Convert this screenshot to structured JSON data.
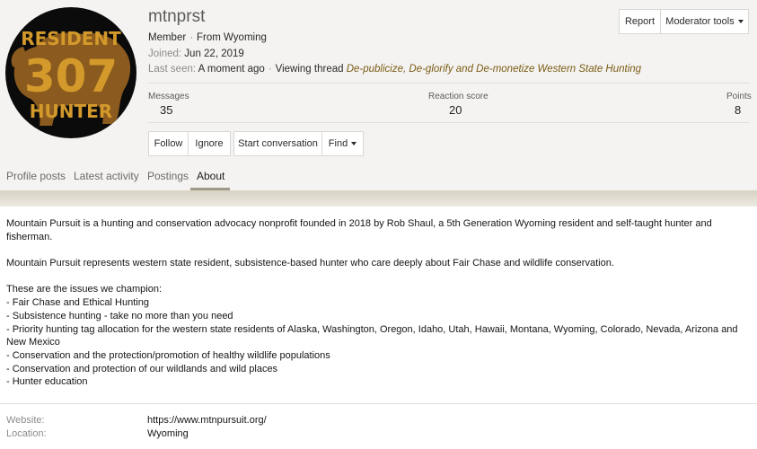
{
  "profile": {
    "username": "mtnprst",
    "role": "Member",
    "from": "From Wyoming",
    "joined_label": "Joined:",
    "joined_value": "Jun 22, 2019",
    "last_seen_label": "Last seen:",
    "last_seen_value": "A moment ago",
    "activity_text": "Viewing thread",
    "activity_thread": "De-publicize, De-glorify and De-monetize Western State Hunting",
    "avatar_text": [
      "RESIDENT",
      "307",
      "HUNTER"
    ]
  },
  "actions": {
    "report": "Report",
    "moderator_tools": "Moderator tools",
    "follow": "Follow",
    "ignore": "Ignore",
    "start_conversation": "Start conversation",
    "find": "Find"
  },
  "stats": {
    "messages_label": "Messages",
    "messages_value": "35",
    "reaction_label": "Reaction score",
    "reaction_value": "20",
    "points_label": "Points",
    "points_value": "8"
  },
  "tabs": [
    "Profile posts",
    "Latest activity",
    "Postings",
    "About"
  ],
  "active_tab": "About",
  "about": {
    "paragraph1": "Mountain Pursuit is a hunting and conservation advocacy nonprofit founded in 2018 by Rob Shaul, a 5th Generation Wyoming resident and self-taught hunter and fisherman.",
    "paragraph2": "Mountain Pursuit represents western state resident, subsistence-based hunter who care deeply about Fair Chase and wildlife conservation.",
    "issues_intro": "These are the issues we champion:",
    "issues": [
      "- Fair Chase and Ethical Hunting",
      "- Subsistence hunting - take no more than you need",
      "- Priority hunting tag allocation for the western state residents of Alaska, Washington, Oregon, Idaho, Utah, Hawaii, Montana, Wyoming, Colorado, Nevada, Arizona and New Mexico",
      "- Conservation and the protection/promotion of healthy wildlife populations",
      "- Conservation and protection of our wildlands and wild places",
      "- Hunter education"
    ]
  },
  "info": {
    "website_label": "Website:",
    "website_value": "https://www.mtnpursuit.org/",
    "location_label": "Location:",
    "location_value": "Wyoming"
  },
  "colors": {
    "header_bg": "#f4f3f1",
    "avatar_gold": "#d39a2b",
    "avatar_brown": "#8b5a1e",
    "link_gold": "#7a5c14",
    "tab_underline": "#a09a8b"
  },
  "icons": {
    "dropdown": "chevron-down-icon",
    "separator": "middle-dot"
  }
}
